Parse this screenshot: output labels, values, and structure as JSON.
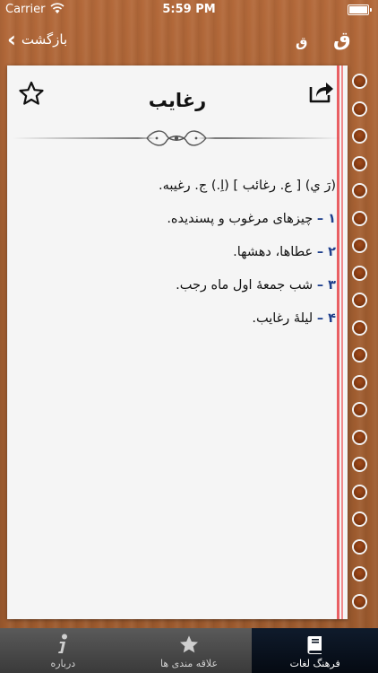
{
  "status": {
    "carrier": "Carrier",
    "time": "5:59 PM"
  },
  "nav": {
    "back_label": "بازگشت",
    "font_small": "ق",
    "font_large": "ق"
  },
  "entry": {
    "title": "رغایب",
    "lines": [
      {
        "num": "",
        "text": "(رَ ي) [ ع. رغائب ] (اِ.) ج. رغيبه."
      },
      {
        "num": "۱ –",
        "text": "چیزهای مرغوب و پسندیده."
      },
      {
        "num": "۲ –",
        "text": "عطاها، دهشها."
      },
      {
        "num": "۳ –",
        "text": "شب جمعهٔ اول ماه رجب."
      },
      {
        "num": "۴ –",
        "text": "لیلهٔ رغایب."
      }
    ]
  },
  "tabs": [
    {
      "label": "درباره",
      "icon": "info-icon"
    },
    {
      "label": "علاقه مندی ها",
      "icon": "star-icon"
    },
    {
      "label": "فرهنگ لغات",
      "icon": "book-icon"
    }
  ],
  "colors": {
    "number_blue": "#1e3f8c",
    "margin_red": "#e95f63",
    "tab_active": "#0a1422"
  }
}
